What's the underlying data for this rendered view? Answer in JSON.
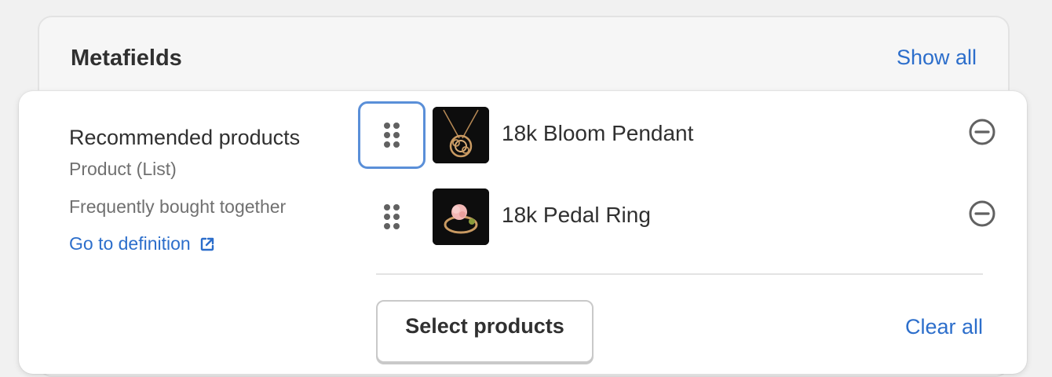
{
  "section": {
    "title": "Metafields",
    "show_all_label": "Show all"
  },
  "field": {
    "name": "Recommended products",
    "type": "Product (List)",
    "description": "Frequently bought together",
    "definition_link": "Go to definition"
  },
  "products": [
    {
      "title": "18k Bloom Pendant",
      "thumbnail_icon": "pendant-image"
    },
    {
      "title": "18k Pedal Ring",
      "thumbnail_icon": "ring-image"
    }
  ],
  "actions": {
    "select_label": "Select products",
    "clear_label": "Clear all"
  },
  "colors": {
    "link": "#2c6ecb",
    "focus_ring": "#5a8fd8",
    "text": "#303030",
    "subdued": "#707070"
  }
}
